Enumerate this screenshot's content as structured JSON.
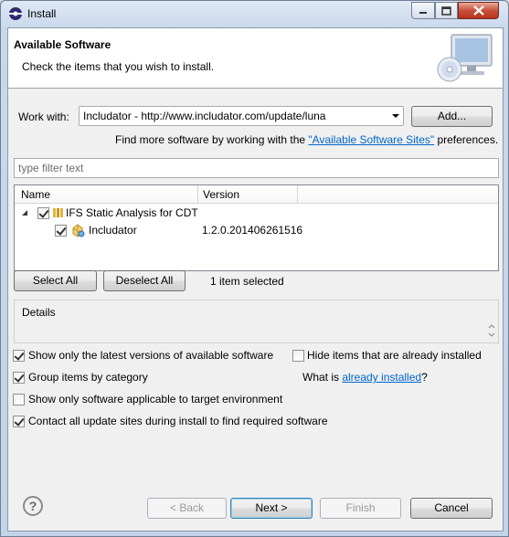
{
  "window": {
    "title": "Install"
  },
  "banner": {
    "title": "Available Software",
    "description": "Check the items that you wish to install."
  },
  "work_with": {
    "label": "Work with:",
    "value": "Includator - http://www.includator.com/update/luna",
    "add_button": "Add...",
    "more_prefix": "Find more software by working with the ",
    "more_link": "\"Available Software Sites\"",
    "more_suffix": " preferences."
  },
  "filter": {
    "placeholder": "type filter text"
  },
  "tree": {
    "columns": [
      "Name",
      "Version"
    ],
    "rows": [
      {
        "name": "IFS Static Analysis for CDT",
        "version": "",
        "checked": true,
        "icon": "category-icon"
      },
      {
        "name": "Includator",
        "version": "1.2.0.201406261516",
        "checked": true,
        "icon": "feature-icon"
      }
    ]
  },
  "selection": {
    "select_all": "Select All",
    "deselect_all": "Deselect All",
    "status": "1 item selected"
  },
  "details": {
    "label": "Details"
  },
  "options": {
    "latest_versions": {
      "label": "Show only the latest versions of available software",
      "checked": true
    },
    "hide_installed": {
      "label": "Hide items that are already installed",
      "checked": false
    },
    "group_by_category": {
      "label": "Group items by category",
      "checked": true
    },
    "what_is_prefix": "What is ",
    "what_is_link": "already installed",
    "what_is_suffix": "?",
    "target_env": {
      "label": "Show only software applicable to target environment",
      "checked": false
    },
    "contact_sites": {
      "label": "Contact all update sites during install to find required software",
      "checked": true
    }
  },
  "footer": {
    "back": "< Back",
    "next": "Next >",
    "finish": "Finish",
    "cancel": "Cancel"
  }
}
